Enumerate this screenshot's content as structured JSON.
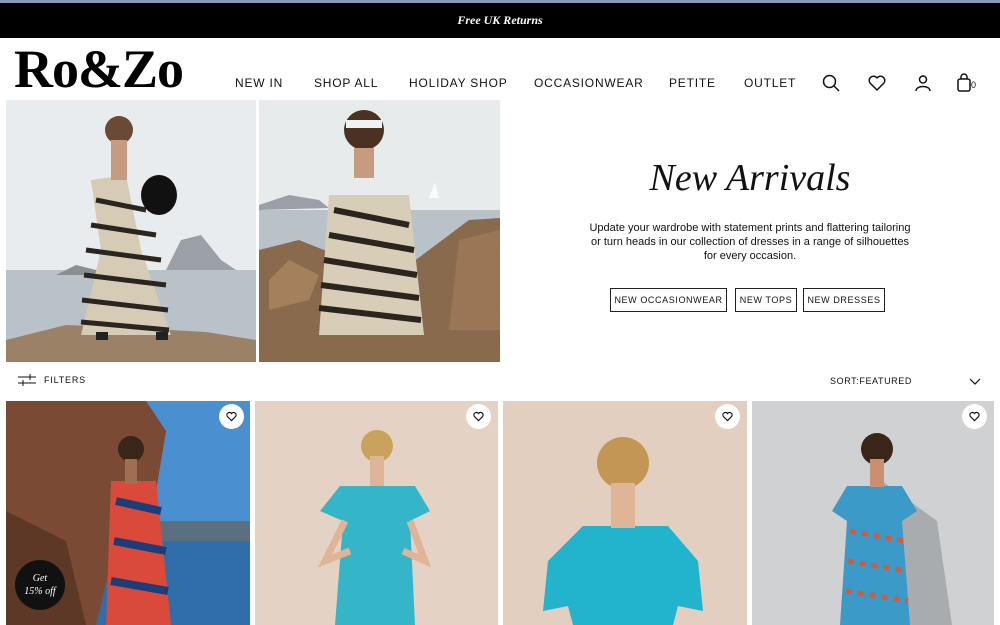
{
  "announcement": "Free UK Returns",
  "brand": "Ro&Zo",
  "nav": [
    "NEW IN",
    "SHOP ALL",
    "HOLIDAY SHOP",
    "OCCASIONWEAR",
    "PETITE",
    "OUTLET"
  ],
  "header_icons": [
    "search-icon",
    "heart-icon",
    "account-icon",
    "bag-icon"
  ],
  "cart_count": "0",
  "hero": {
    "title": "New Arrivals",
    "description": "Update your wardrobe with statement prints and flattering tailoring or turn heads in our collection of dresses in a range of silhouettes for every occasion.",
    "buttons": [
      "NEW OCCASIONWEAR",
      "NEW TOPS",
      "NEW DRESSES"
    ]
  },
  "filter_label": "FILTERS",
  "sort_label": "SORT:FEATURED",
  "promo_badge": {
    "line1": "Get",
    "line2": "15% off"
  },
  "colors": {
    "announcement_bg": "#000000",
    "badge_bg": "#111111"
  }
}
